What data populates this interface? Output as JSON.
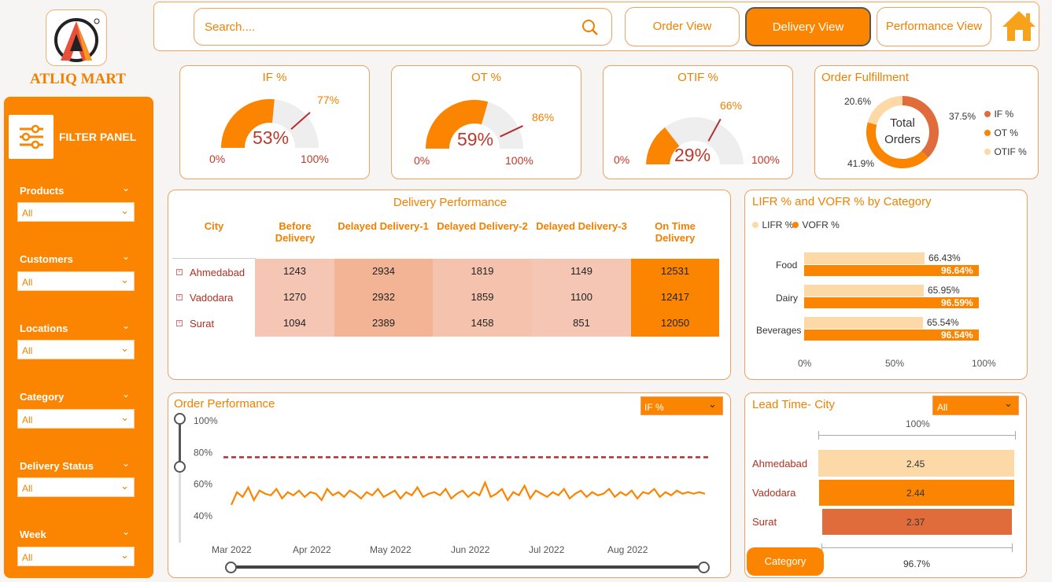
{
  "brand": {
    "name": "ATLIQ MART"
  },
  "filter_panel": {
    "title": "FILTER PANEL",
    "filters": [
      {
        "label": "Products",
        "value": "All"
      },
      {
        "label": "Customers",
        "value": "All"
      },
      {
        "label": "Locations",
        "value": "All"
      },
      {
        "label": "Category",
        "value": "All"
      },
      {
        "label": "Delivery Status",
        "value": "All"
      },
      {
        "label": "Week",
        "value": "All"
      }
    ]
  },
  "topbar": {
    "search_placeholder": "Search....",
    "nav": [
      "Order View",
      "Delivery View",
      "Performance View"
    ],
    "active": "Delivery View"
  },
  "kpis": [
    {
      "title": "IF %",
      "value": "53%",
      "value_num": 53,
      "target": "77%",
      "target_num": 77,
      "min": "0%",
      "max": "100%"
    },
    {
      "title": "OT %",
      "value": "59%",
      "value_num": 59,
      "target": "86%",
      "target_num": 86,
      "min": "0%",
      "max": "100%"
    },
    {
      "title": "OTIF %",
      "value": "29%",
      "value_num": 29,
      "target": "66%",
      "target_num": 66,
      "min": "0%",
      "max": "100%"
    }
  ],
  "order_fulfillment": {
    "title": "Order Fulfillment",
    "center_line1": "Total",
    "center_line2": "Orders",
    "slices": [
      {
        "name": "IF %",
        "label": "37.5%",
        "value": 37.5,
        "color": "#e06c3c"
      },
      {
        "name": "OT %",
        "label": "41.9%",
        "value": 41.9,
        "color": "#fb8500"
      },
      {
        "name": "OTIF %",
        "label": "20.6%",
        "value": 20.6,
        "color": "#fdd9a8"
      }
    ]
  },
  "delivery_performance": {
    "title": "Delivery Performance",
    "headers": [
      "City",
      "Before Delivery",
      "Delayed Delivery-1",
      "Delayed Delivery-2",
      "Delayed Delivery-3",
      "On Time Delivery"
    ],
    "header_lines": [
      [
        "City"
      ],
      [
        "Before",
        "Delivery"
      ],
      [
        "Delayed Delivery-1"
      ],
      [
        "Delayed Delivery-2"
      ],
      [
        "Delayed Delivery-3"
      ],
      [
        "On Time",
        "Delivery"
      ]
    ],
    "rows": [
      {
        "city": "Ahmedabad",
        "values": [
          "1243",
          "2934",
          "1819",
          "1149",
          "12531"
        ]
      },
      {
        "city": "Vadodara",
        "values": [
          "1270",
          "2932",
          "1859",
          "1100",
          "12417"
        ]
      },
      {
        "city": "Surat",
        "values": [
          "1094",
          "2389",
          "1458",
          "851",
          "12050"
        ]
      }
    ],
    "expand_symbol": "+"
  },
  "lifr_vofr": {
    "title": "LIFR % and VOFR % by Category",
    "legend": [
      "LIFR %",
      "VOFR %"
    ],
    "colors": {
      "LIFR %": "#fdd9a8",
      "VOFR %": "#fb8500"
    },
    "x_ticks": [
      "0%",
      "50%",
      "100%"
    ],
    "categories": [
      {
        "name": "Food",
        "lifr": "66.43%",
        "lifr_num": 66.43,
        "vofr": "96.64%",
        "vofr_num": 96.64
      },
      {
        "name": "Dairy",
        "lifr": "65.95%",
        "lifr_num": 65.95,
        "vofr": "96.59%",
        "vofr_num": 96.59
      },
      {
        "name": "Beverages",
        "lifr": "65.54%",
        "lifr_num": 65.54,
        "vofr": "96.54%",
        "vofr_num": 96.54
      }
    ]
  },
  "order_performance": {
    "title": "Order Performance",
    "dropdown": "IF %",
    "y_ticks": [
      "100%",
      "80%",
      "60%",
      "40%"
    ],
    "x_ticks": [
      "Mar 2022",
      "Apr 2022",
      "May 2022",
      "Jun 2022",
      "Jul 2022",
      "Aug 2022"
    ]
  },
  "lead_time": {
    "title": "Lead Time- City",
    "dropdown": "All",
    "top_label": "100%",
    "bottom_label": "96.7%",
    "button": "Category",
    "rows": [
      {
        "city": "Ahmedabad",
        "value": "2.45",
        "num": 2.45,
        "color": "#fdd9a8"
      },
      {
        "city": "Vadodara",
        "value": "2.44",
        "num": 2.44,
        "color": "#fb8500"
      },
      {
        "city": "Surat",
        "value": "2.37",
        "num": 2.37,
        "color": "#e06c3c"
      }
    ]
  },
  "chart_data": {
    "type": "line",
    "title": "Order Performance",
    "series": [
      {
        "name": "IF %",
        "values": [
          47,
          55,
          52,
          58,
          50,
          56,
          54,
          53,
          57,
          51,
          55,
          53,
          56,
          52,
          55,
          54,
          50,
          57,
          53,
          55,
          52,
          56,
          54,
          51,
          55,
          53,
          57,
          52,
          54,
          56,
          51,
          55,
          53,
          58,
          52,
          54,
          55,
          53,
          57,
          51,
          54,
          56,
          52,
          55,
          53,
          61,
          52,
          54,
          57,
          50,
          55,
          53,
          59,
          51,
          56,
          54,
          52,
          55,
          53,
          57,
          51,
          54,
          56,
          52,
          55,
          53,
          54,
          57,
          52,
          55,
          53,
          56,
          51,
          55,
          54,
          57,
          52,
          55,
          53,
          56,
          54,
          55,
          54,
          55,
          54
        ]
      }
    ],
    "reference_line": 77,
    "ylim": [
      35,
      100
    ]
  }
}
